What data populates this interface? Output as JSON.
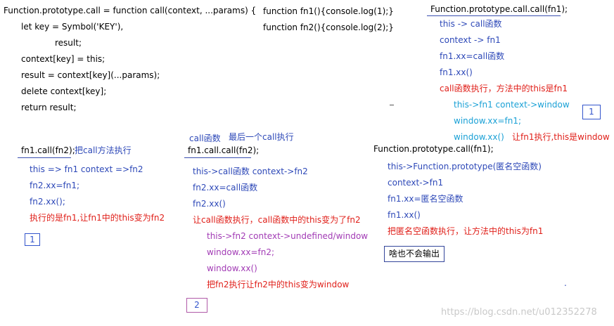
{
  "call_impl": {
    "l1": "Function.prototype.call = function call(context, ...params) {",
    "l2": "let key = Symbol('KEY'),",
    "l3": "result;",
    "l4": "context[key] = this;",
    "l5": "result = context[key](...params);",
    "l6": "delete context[key];",
    "l7": "return result;"
  },
  "fn_defs": {
    "l1": "function fn1(){console.log(1);}",
    "l2": "function fn2(){console.log(2);}"
  },
  "ex1": {
    "head": "fn1.call(fn2);",
    "note": "把call方法执行",
    "l1": "this => fn1    context =>fn2",
    "l2": "fn2.xx=fn1;",
    "l3": "fn2.xx();",
    "l4": "执行的是fn1,让fn1中的this变为fn2",
    "badge": "1"
  },
  "ex2": {
    "label_a": "call函数",
    "label_b": "最后一个call执行",
    "head": "fn1.call.call(fn2);",
    "l1": "this->call函数    context->fn2",
    "l2": "fn2.xx=call函数",
    "l3": "fn2.xx()",
    "l4": "让call函数执行，call函数中的this变为了fn2",
    "s1": "this->fn2    context->undefined/window",
    "s2": "window.xx=fn2;",
    "s3": "window.xx()",
    "s4": "把fn2执行让fn2中的this变为window",
    "badge": "2"
  },
  "ex3": {
    "head": "Function.prototype.call.call(fn1);",
    "l1": "this -> call函数",
    "l2": "context -> fn1",
    "l3": "fn1.xx=call函数",
    "l4": "fn1.xx()",
    "l5": "call函数执行，方法中的this是fn1",
    "s1": "this->fn1   context->window",
    "s2": "window.xx=fn1;",
    "s3": "window.xx()",
    "s4": "让fn1执行,this是window",
    "badge": "1",
    "dash": "-"
  },
  "ex4": {
    "head": "Function.prototype.call(fn1);",
    "l1": "this->Function.prototype(匿名空函数)",
    "l2": "context->fn1",
    "l3": "fn1.xx=匿名空函数",
    "l4": "fn1.xx()",
    "l5": "把匿名空函数执行，让方法中的this为fn1",
    "badge": "啥也不会输出"
  },
  "stray_dot": ".",
  "watermark": "https://blog.csdn.net/u012352278",
  "colors": {
    "code": "#000000",
    "explain": "#2e49b8",
    "conclusion": "#e0201a",
    "nested_cyan": "#1ba1d6",
    "nested_purple": "#a23bb5"
  }
}
